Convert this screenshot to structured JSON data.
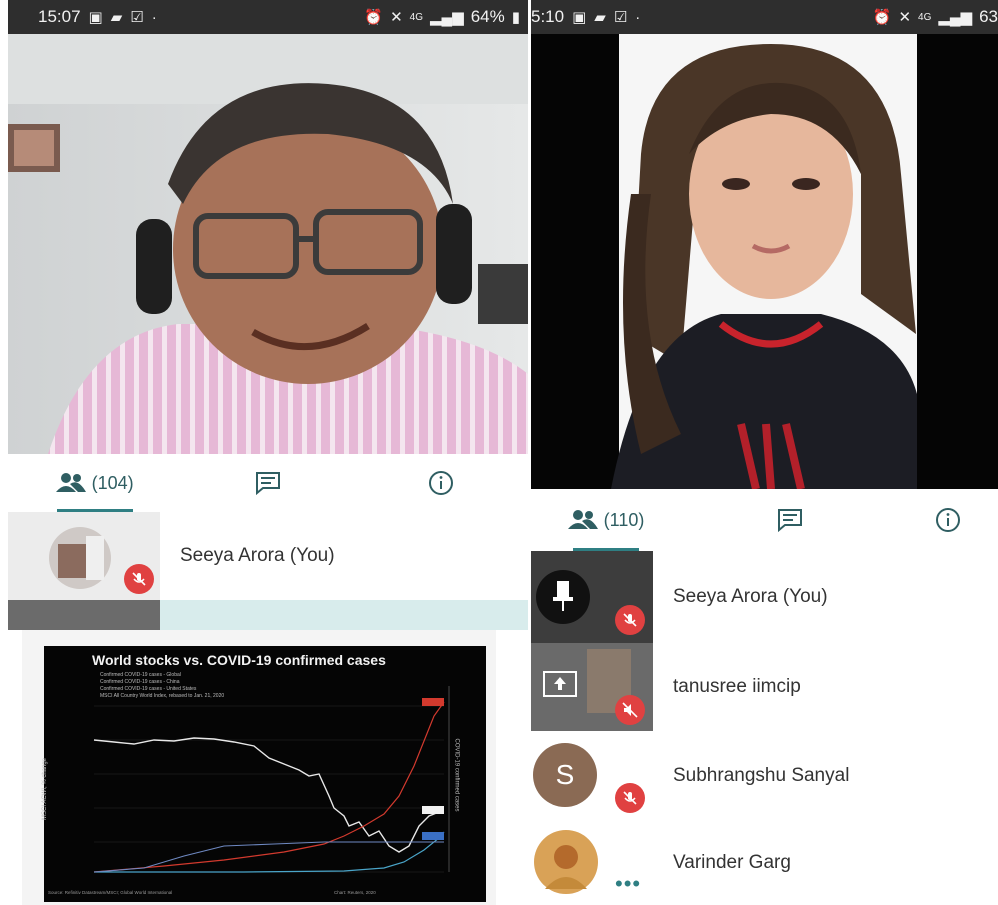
{
  "left": {
    "status": {
      "time": "15:07",
      "battery": "64%",
      "network": "4G"
    },
    "tabs": [
      {
        "label": "(104)",
        "icon": "people-icon"
      },
      {
        "label": "",
        "icon": "chat-icon"
      },
      {
        "label": "",
        "icon": "info-icon"
      }
    ],
    "participants": [
      {
        "name": "Seeya Arora (You)"
      }
    ],
    "shared_slide": {
      "title": "World stocks vs. COVID-19 confirmed cases",
      "legend": [
        "Confirmed COVID-19 cases - Global",
        "Confirmed COVID-19 cases - China",
        "Confirmed COVID-19 cases - United States",
        "MSCI All Country World Index, rebased to Jan. 21, 2020"
      ],
      "ylabel_left": "MSCI ACWI, % change",
      "ylabel_right": "COVID-19 confirmed cases",
      "source": "Source: Refinitiv Datastream/MSCI; Global World International",
      "credit": "Chart: Reuters, 2020"
    }
  },
  "right": {
    "status": {
      "time": "5:10",
      "battery": "63",
      "network": "4G"
    },
    "tabs": [
      {
        "label": "(110)",
        "icon": "people-icon"
      },
      {
        "label": "",
        "icon": "chat-icon"
      },
      {
        "label": "",
        "icon": "info-icon"
      }
    ],
    "participants": [
      {
        "name": "Seeya Arora (You)"
      },
      {
        "name": "tanusree iimcip"
      },
      {
        "name": "Subhrangshu Sanyal",
        "initial": "S"
      },
      {
        "name": "Varinder Garg"
      }
    ]
  },
  "colors": {
    "accent": "#2f7f83",
    "mute": "#e04141",
    "tab_text": "#2f5e62"
  }
}
